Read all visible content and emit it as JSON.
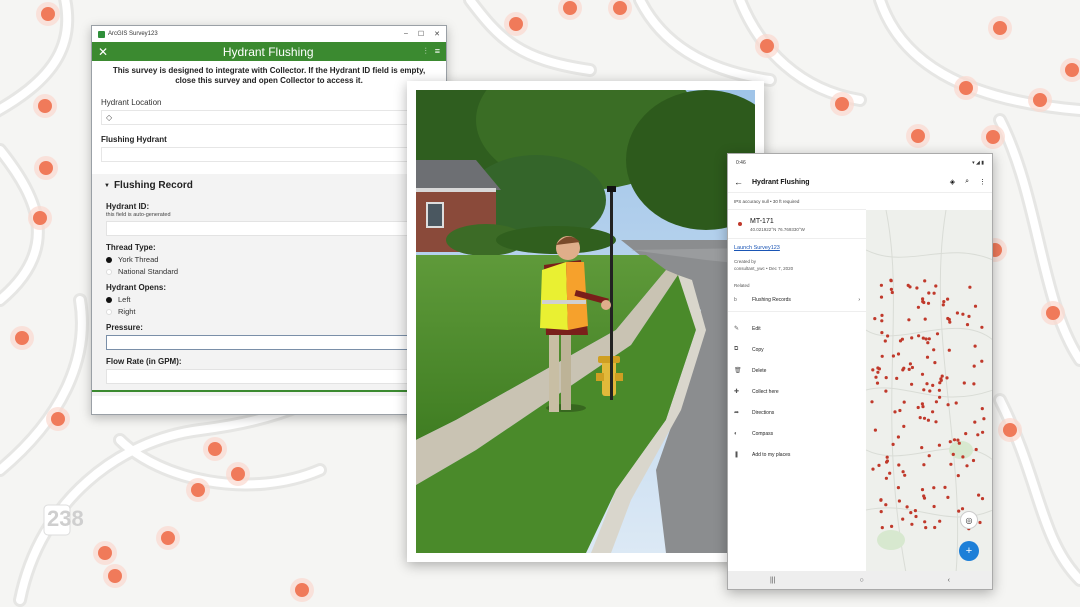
{
  "survey": {
    "app_name": "ArcGIS Survey123",
    "win_min": "–",
    "win_max": "☐",
    "win_close": "✕",
    "header_close": "✕",
    "header_icons": [
      "⫶",
      "≡"
    ],
    "title": "Hydrant Flushing",
    "intro": "This survey is designed to integrate with Collector. If the Hydrant ID field is empty, close this survey and open Collector to access it.",
    "location_label": "Hydrant Location",
    "location_icon": "◇",
    "flushing_hydrant_label": "Flushing Hydrant",
    "group_caret": "▼",
    "group_title": "Flushing Record",
    "hydrant_id_label": "Hydrant ID:",
    "hydrant_id_note": "this field is auto-generated",
    "thread_type_label": "Thread Type:",
    "thread_options": [
      "York Thread",
      "National Standard"
    ],
    "hydrant_opens_label": "Hydrant Opens:",
    "opens_options": [
      "Left",
      "Right"
    ],
    "pressure_label": "Pressure:",
    "flow_rate_label": "Flow Rate (in GPM):"
  },
  "phone": {
    "status_time": "0:46",
    "status_icons": "▾ ◢ ▮",
    "back_icon": "←",
    "title": "Hydrant Flushing",
    "action_icons": [
      "◈",
      "⌕",
      "⋮"
    ],
    "gps_text": "IPS accuracy null  •  30 ft required",
    "feature_id": "MT-171",
    "feature_coords": "40.021922°N  76.769330°W",
    "launch_link": "Launch Survey123",
    "created_by_label": "Created by",
    "created_by_value": "consultant_ywc • Dec 7, 2020",
    "related_label": "Related",
    "related_lead": "b",
    "related_item": "Flushing Records",
    "related_chevron": "›",
    "actions": [
      {
        "icon": "✎",
        "label": "Edit"
      },
      {
        "icon": "⧉",
        "label": "Copy"
      },
      {
        "icon": "🗑",
        "label": "Delete"
      },
      {
        "icon": "✚",
        "label": "Collect here"
      },
      {
        "icon": "➦",
        "label": "Directions"
      },
      {
        "icon": "◐",
        "label": "Compass"
      },
      {
        "icon": "❚",
        "label": "Add to my places"
      }
    ],
    "nav_icons": [
      "|||",
      "○",
      "‹"
    ],
    "fab_icon": "+",
    "locate_icon": "◎"
  },
  "colors": {
    "survey_green": "#3b8a30",
    "hydrant_red": "#c0392b",
    "bg_point": "#f07a5a",
    "fab_blue": "#1d7fd8"
  }
}
